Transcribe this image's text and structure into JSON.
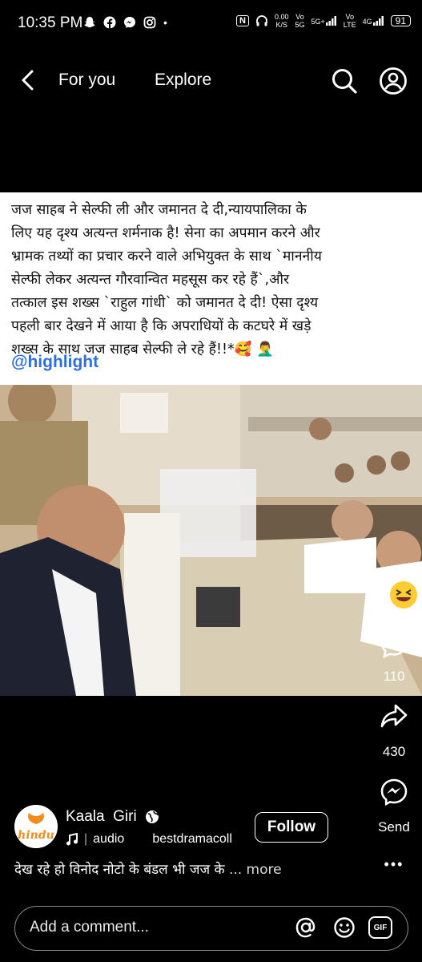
{
  "status_bar": {
    "time": "10:35 PM",
    "notif_icons": [
      "snapchat-icon",
      "facebook-icon",
      "messenger-icon",
      "instagram-icon"
    ],
    "dot": "•",
    "nfc": "N",
    "speed_top": "0.00",
    "speed_bottom": "K/S",
    "vo1_top": "Vo",
    "vo1_bottom": "5G",
    "net1": "5G+",
    "vo2_top": "Vo",
    "vo2_bottom": "LTE",
    "net2": "4G",
    "battery": "91"
  },
  "nav": {
    "tab_for_you": "For you",
    "tab_explore": "Explore"
  },
  "post": {
    "text_lines": [
      "जज साहब ने सेल्फी ली और जमानत दे दी,न्यायपालिका के",
      "लिए यह दृश्य अत्यन्त शर्मनाक है! सेना का अपमान करने और",
      "भ्रामक तथ्यों का प्रचार करने वाले अभियुक्त के साथ `माननीय",
      "सेल्फी लेकर अत्यन्त गौरवान्वित महसूस कर रहे हैं`,और",
      "तत्काल इस शख्स `राहुल गांधी` को जमानत दे दी! ऐसा दृश्य",
      "पहली बार देखने में आया है कि अपराधियों के कटघरे में खड़े",
      "शख्स के साथ जज साहब सेल्फी ले रहे हैं!!*🥰 🤦‍♂️"
    ],
    "hashtag": "@highlight"
  },
  "actions": {
    "comments": "110",
    "shares": "430",
    "send_label": "Send",
    "more_label": "•••"
  },
  "author": {
    "avatar_text": "hindu",
    "name": "Kaala  Giri",
    "audio_label": "audio",
    "audio_separator": "|",
    "audio_source": "bestdramacoll",
    "follow_label": "Follow"
  },
  "caption": {
    "text": "देख रहे हो विनोद नोटो के बंडल भी जज के",
    "more": "... more"
  },
  "comment_input": {
    "placeholder": "Add a comment...",
    "gif_label": "GIF"
  },
  "colors": {
    "background": "#000000",
    "hashtag": "#2d6ee0",
    "avatar_brand": "#f28c1b"
  }
}
